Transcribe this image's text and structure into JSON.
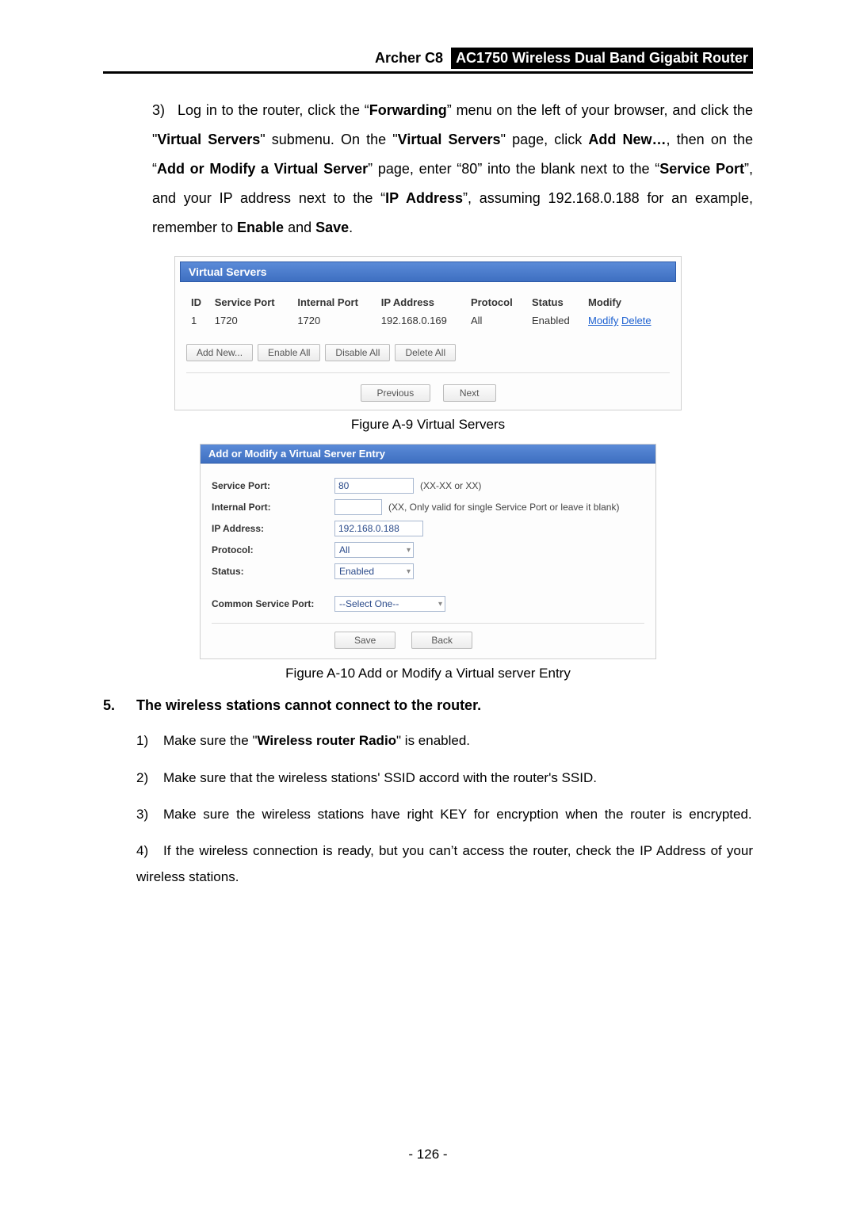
{
  "header": {
    "model": "Archer C8",
    "product": "AC1750 Wireless Dual Band Gigabit Router"
  },
  "step3": {
    "num": "3)",
    "text_prefix": "Log in to the router, click the “",
    "forwarding": "Forwarding",
    "text_a": "” menu on the left of your browser, and click the \"",
    "virtual_servers1": "Virtual Servers",
    "text_b": "\" submenu. On the \"",
    "virtual_servers2": "Virtual Servers",
    "text_c": "\" page, click ",
    "add_new": "Add New…",
    "text_d": ", then on the “",
    "add_modify": "Add or Modify a Virtual Server",
    "text_e": "” page, enter “80” into the blank next to the “",
    "service_port": "Service Port",
    "text_f": "”, and your IP address next to the “",
    "ip_address": "IP Address",
    "text_g": "”, assuming 192.168.0.188 for an example, remember to ",
    "enable": "Enable",
    "and": " and ",
    "save": "Save",
    "period": "."
  },
  "vs": {
    "title": "Virtual Servers",
    "headers": {
      "id": "ID",
      "service_port": "Service Port",
      "internal_port": "Internal Port",
      "ip_address": "IP Address",
      "protocol": "Protocol",
      "status": "Status",
      "modify": "Modify"
    },
    "row": {
      "id": "1",
      "service_port": "1720",
      "internal_port": "1720",
      "ip_address": "192.168.0.169",
      "protocol": "All",
      "status": "Enabled",
      "modify": "Modify",
      "delete": "Delete"
    },
    "buttons": {
      "add_new": "Add New...",
      "enable_all": "Enable All",
      "disable_all": "Disable All",
      "delete_all": "Delete All",
      "previous": "Previous",
      "next": "Next"
    },
    "caption": "Figure A-9 Virtual Servers"
  },
  "am": {
    "title": "Add or Modify a Virtual Server Entry",
    "labels": {
      "service_port": "Service Port:",
      "internal_port": "Internal Port:",
      "ip_address": "IP Address:",
      "protocol": "Protocol:",
      "status": "Status:",
      "common_service_port": "Common Service Port:"
    },
    "values": {
      "service_port": "80",
      "service_port_hint": "(XX-XX or XX)",
      "internal_port": "",
      "internal_port_hint": "(XX, Only valid for single Service Port or leave it blank)",
      "ip_address": "192.168.0.188",
      "protocol": "All",
      "status": "Enabled",
      "common_service_port": "--Select One--"
    },
    "buttons": {
      "save": "Save",
      "back": "Back"
    },
    "caption": "Figure A-10 Add or Modify a Virtual server Entry"
  },
  "section5": {
    "num": "5.",
    "heading": "The wireless stations cannot connect to the router.",
    "items": [
      {
        "n": "1)",
        "pre": "Make sure the \"",
        "bold": "Wireless router Radio",
        "post": "\" is enabled."
      },
      {
        "n": "2)",
        "text": "Make sure that the wireless stations' SSID accord with the router's SSID."
      },
      {
        "n": "3)",
        "text": "Make sure the wireless stations have right KEY for encryption when the router is encrypted."
      },
      {
        "n": "4)",
        "text": "If the wireless connection is ready, but you can’t access the router, check the IP Address of your wireless stations."
      }
    ]
  },
  "page_number": "- 126 -"
}
